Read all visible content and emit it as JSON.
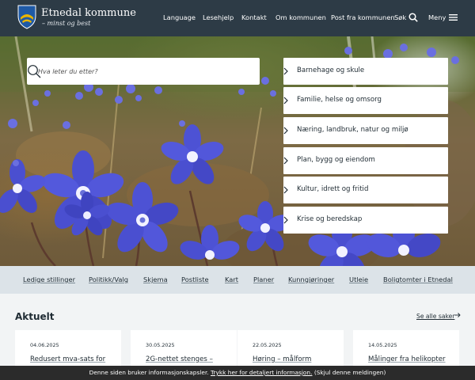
{
  "header": {
    "site_name": "Etnedal kommune",
    "slogan": "– minst og best",
    "nav": [
      "Language",
      "Lesehjelp",
      "Kontakt",
      "Om kommunen",
      "Post fra kommunen"
    ],
    "search_label": "Søk",
    "menu_label": "Meny",
    "colors": {
      "background": "#2d3b46",
      "shield_blue": "#1f5aa6",
      "shield_gold": "#e8b400"
    }
  },
  "hero": {
    "search_placeholder": "Hva leter du etter?",
    "categories": [
      "Barnehage og skule",
      "Familie, helse og omsorg",
      "Næring, landbruk, natur og miljø",
      "Plan, bygg og eiendom",
      "Kultur, idrett og fritid",
      "Krise og beredskap"
    ]
  },
  "quick_links": [
    "Ledige stillinger",
    "Politikk/Valg",
    "Skjema",
    "Postliste",
    "Kart",
    "Planer",
    "Kunngjøringer",
    "Utleie",
    "Boligtomter i Etnedal"
  ],
  "news": {
    "title": "Aktuelt",
    "see_all": "Se alle saker",
    "items": [
      {
        "date": "04.06.2025",
        "title": "Redusert mva-sats for"
      },
      {
        "date": "30.05.2025",
        "title": "2G-nettet stenges –"
      },
      {
        "date": "22.05.2025",
        "title": "Høring – målform"
      },
      {
        "date": "14.05.2025",
        "title": "Målinger fra helikopter"
      }
    ]
  },
  "cookie_bar": {
    "text_before": "Denne siden bruker informasjonskapsler.",
    "link": "Trykk her for detaljert informasjon.",
    "text_after": "(Skjul denne meldingen)"
  }
}
